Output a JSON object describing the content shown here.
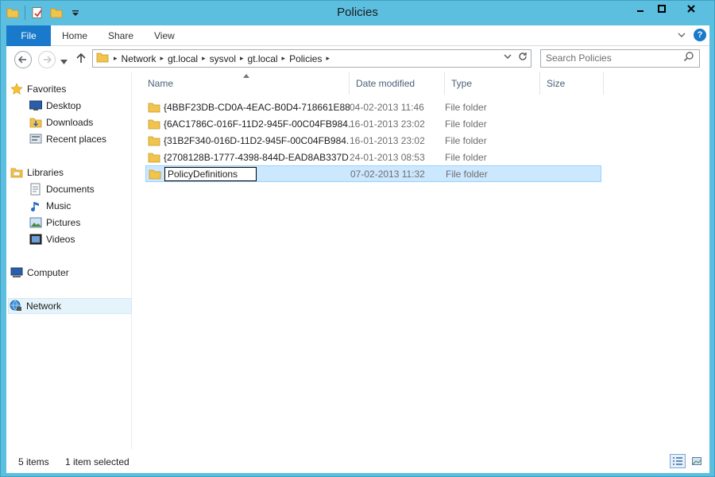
{
  "window": {
    "title": "Policies"
  },
  "ribbon": {
    "tabs": [
      "File",
      "Home",
      "Share",
      "View"
    ]
  },
  "address": {
    "crumbs": [
      "Network",
      "gt.local",
      "sysvol",
      "gt.local",
      "Policies"
    ]
  },
  "search": {
    "placeholder": "Search Policies"
  },
  "nav": {
    "favorites": "Favorites",
    "favorites_items": [
      "Desktop",
      "Downloads",
      "Recent places"
    ],
    "libraries": "Libraries",
    "libraries_items": [
      "Documents",
      "Music",
      "Pictures",
      "Videos"
    ],
    "computer": "Computer",
    "network": "Network"
  },
  "columns": {
    "name": "Name",
    "date": "Date modified",
    "type": "Type",
    "size": "Size"
  },
  "files": [
    {
      "name": "{4BBF23DB-CD0A-4EAC-B0D4-718661E88...",
      "date": "04-02-2013 11:46",
      "type": "File folder"
    },
    {
      "name": "{6AC1786C-016F-11D2-945F-00C04FB984...",
      "date": "16-01-2013 23:02",
      "type": "File folder"
    },
    {
      "name": "{31B2F340-016D-11D2-945F-00C04FB984...",
      "date": "16-01-2013 23:02",
      "type": "File folder"
    },
    {
      "name": "{2708128B-1777-4398-844D-EAD8AB337D...",
      "date": "24-01-2013 08:53",
      "type": "File folder"
    },
    {
      "name": "PolicyDefinitions",
      "date": "07-02-2013 11:32",
      "type": "File folder"
    }
  ],
  "status": {
    "items": "5 items",
    "selected": "1 item selected"
  },
  "colors": {
    "file_tab": "#1979ca",
    "frame": "#5cbfe0",
    "selection": "#cce8ff"
  }
}
